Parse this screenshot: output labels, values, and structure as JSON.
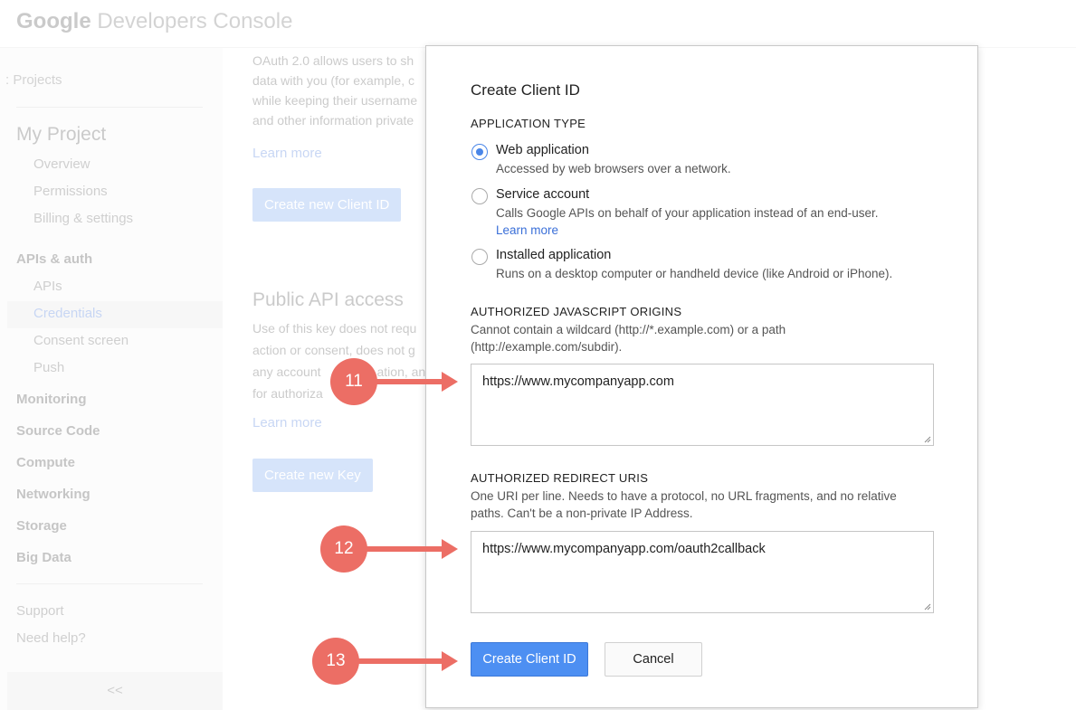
{
  "console": {
    "logo_google": "Google",
    "logo_rest": "Developers Console",
    "sidebar": {
      "projects": ": Projects",
      "project_name": "My Project",
      "project_items": [
        "Overview",
        "Permissions",
        "Billing & settings"
      ],
      "apis_header": "APIs & auth",
      "apis_items": [
        "APIs",
        "Credentials",
        "Consent screen",
        "Push"
      ],
      "sections": [
        "Monitoring",
        "Source Code",
        "Compute",
        "Networking",
        "Storage",
        "Big Data"
      ],
      "support": "Support",
      "need_help": "Need help?",
      "collapse": "<<"
    },
    "main": {
      "oauth_lines": [
        "OAuth 2.0 allows users to sh",
        "data with you (for example, c",
        "while keeping their username",
        "and other information private"
      ],
      "learn_more_1": "Learn more",
      "create_client_btn": "Create new Client ID",
      "public_api_title": "Public API access",
      "public_lines": [
        "Use of this key does not requ",
        "action or consent, does not g",
        "any account",
        "for authoriza"
      ],
      "public_line3_tail": "ation, and",
      "learn_more_2": "Learn more",
      "create_key_btn": "Create new Key"
    }
  },
  "dialog": {
    "title": "Create Client ID",
    "app_type_label": "APPLICATION TYPE",
    "options": [
      {
        "label": "Web application",
        "desc": "Accessed by web browsers over a network.",
        "checked": true
      },
      {
        "label": "Service account",
        "desc": "Calls Google APIs on behalf of your application instead of an end-user.",
        "link": "Learn more",
        "checked": false
      },
      {
        "label": "Installed application",
        "desc": "Runs on a desktop computer or handheld device (like Android or iPhone).",
        "checked": false
      }
    ],
    "js_origins": {
      "label": "AUTHORIZED JAVASCRIPT ORIGINS",
      "help_1": "Cannot contain a wildcard (http://*.example.com) or a path",
      "help_2": "(http://example.com/subdir).",
      "value": "https://www.mycompanyapp.com"
    },
    "redirect_uris": {
      "label": "AUTHORIZED REDIRECT URIS",
      "help_1": "One URI per line. Needs to have a protocol, no URL fragments, and no relative",
      "help_2": "paths. Can't be a non-private IP Address.",
      "value": "https://www.mycompanyapp.com/oauth2callback"
    },
    "create_btn": "Create Client ID",
    "cancel_btn": "Cancel"
  },
  "annotations": {
    "steps": [
      "11",
      "12",
      "13"
    ],
    "color": "#ec6e65"
  },
  "colors": {
    "primary": "#4d8ff2",
    "link": "#3a6fd8",
    "radio_checked": "#4a86e8"
  }
}
